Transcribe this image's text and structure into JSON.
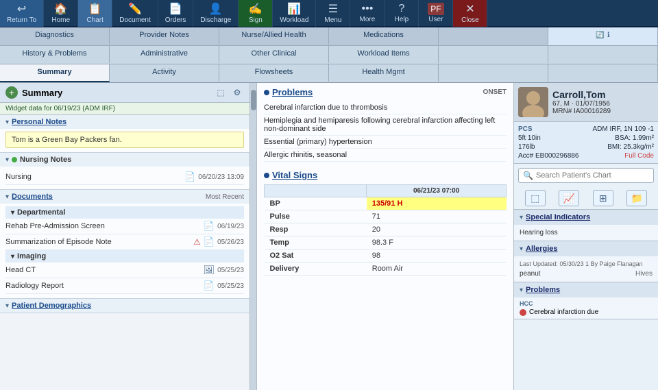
{
  "toolbar": {
    "items": [
      {
        "label": "Return To",
        "icon": "↩",
        "name": "return-to-button"
      },
      {
        "label": "Home",
        "icon": "🏠",
        "name": "home-button"
      },
      {
        "label": "Chart",
        "icon": "📋",
        "name": "chart-button",
        "active": true
      },
      {
        "label": "Document",
        "icon": "✏️",
        "name": "document-button"
      },
      {
        "label": "Orders",
        "icon": "📄",
        "name": "orders-button"
      },
      {
        "label": "Discharge",
        "icon": "👤",
        "name": "discharge-button"
      },
      {
        "label": "Sign",
        "icon": "✍️",
        "name": "sign-button"
      },
      {
        "label": "Workload",
        "icon": "📊",
        "name": "workload-button"
      },
      {
        "label": "Menu",
        "icon": "☰",
        "name": "menu-button"
      },
      {
        "label": "More",
        "icon": "•••",
        "name": "more-button"
      },
      {
        "label": "Help",
        "icon": "?",
        "name": "help-button"
      },
      {
        "label": "PF\nUser",
        "icon": "👤",
        "name": "user-button"
      },
      {
        "label": "Close",
        "icon": "✕",
        "name": "close-button"
      }
    ]
  },
  "nav": {
    "row1": [
      {
        "label": "Diagnostics",
        "name": "nav-diagnostics"
      },
      {
        "label": "Provider Notes",
        "name": "nav-provider-notes"
      },
      {
        "label": "Nurse/Allied Health",
        "name": "nav-nurse"
      },
      {
        "label": "Medications",
        "name": "nav-medications"
      },
      {
        "label": "",
        "name": "nav-empty1"
      },
      {
        "label": "",
        "name": "nav-empty2"
      }
    ],
    "row2": [
      {
        "label": "History & Problems",
        "name": "nav-history"
      },
      {
        "label": "Administrative",
        "name": "nav-administrative"
      },
      {
        "label": "Other Clinical",
        "name": "nav-other-clinical"
      },
      {
        "label": "Workload Items",
        "name": "nav-workload"
      },
      {
        "label": "",
        "name": "nav-empty3"
      },
      {
        "label": "",
        "name": "nav-empty4"
      }
    ],
    "row3": [
      {
        "label": "Summary",
        "name": "nav-summary",
        "active": true
      },
      {
        "label": "Activity",
        "name": "nav-activity"
      },
      {
        "label": "Flowsheets",
        "name": "nav-flowsheets"
      },
      {
        "label": "Health Mgmt",
        "name": "nav-health-mgmt"
      },
      {
        "label": "",
        "name": "nav-empty5"
      },
      {
        "label": "",
        "name": "nav-empty6"
      }
    ]
  },
  "panel": {
    "title": "Summary",
    "widget_info": "Widget data for 06/19/23 (ADM IRF)",
    "add_label": "+",
    "settings_icon": "⚙",
    "expand_icon": "⤢"
  },
  "personal_notes": {
    "title": "Personal Notes",
    "content": "Tom is a Green Bay Packers fan."
  },
  "nursing_notes": {
    "title": "Nursing Notes",
    "dot_color": "green",
    "entries": [
      {
        "name": "Nursing",
        "date": "06/20/23 13:09"
      }
    ]
  },
  "documents": {
    "title": "Documents",
    "most_recent": "Most Recent",
    "subsections": [
      {
        "name": "Departmental",
        "items": [
          {
            "name": "Rehab Pre-Admission Screen",
            "date": "06/19/23",
            "has_icon": true
          },
          {
            "name": "Summarization of Episode Note",
            "date": "05/26/23",
            "has_icon": true,
            "has_warn": true
          }
        ]
      },
      {
        "name": "Imaging",
        "items": [
          {
            "name": "Head CT",
            "date": "05/25/23",
            "has_icon": true
          },
          {
            "name": "Radiology Report",
            "date": "05/25/23",
            "has_icon": true
          }
        ]
      }
    ]
  },
  "patient_demographics": {
    "title": "Patient Demographics",
    "name": "patient-demographics-link"
  },
  "problems": {
    "title": "Problems",
    "onset_label": "ONSET",
    "items": [
      "Cerebral infarction due to thrombosis",
      "Hemiplegia and hemiparesis following cerebral infarction affecting left non-dominant side",
      "Essential (primary) hypertension",
      "Allergic rhinitis, seasonal"
    ]
  },
  "vital_signs": {
    "title": "Vital Signs",
    "date_col": "06/21/23\n07:00",
    "rows": [
      {
        "label": "BP",
        "value": "135/91 H",
        "highlight": true
      },
      {
        "label": "Pulse",
        "value": "71",
        "highlight": false
      },
      {
        "label": "Resp",
        "value": "20",
        "highlight": false
      },
      {
        "label": "Temp",
        "value": "98.3 F",
        "highlight": false
      },
      {
        "label": "O2 Sat",
        "value": "98",
        "highlight": false
      },
      {
        "label": "Delivery",
        "value": "Room Air",
        "highlight": false
      }
    ]
  },
  "patient": {
    "name": "Carroll,Tom",
    "age": "67, M · 01/07/1956",
    "mrn": "MRN# IA00016289",
    "location": "ADM IRF, 1N  109 -1",
    "height": "5ft 10in",
    "weight": "176lb",
    "bsa": "BSA: 1.99m²",
    "bmi": "BMI: 25.3kg/m²",
    "acc": "Acc#\nEB000296886",
    "full_code": "Full Code",
    "pcs_label": "PCS",
    "search_placeholder": "Search Patient's Chart"
  },
  "special_indicators": {
    "title": "Special Indicators",
    "items": [
      "Hearing loss"
    ]
  },
  "allergies": {
    "title": "Allergies",
    "updated": "Last Updated: 05/30/23 1 By Paige Flanagan",
    "items": [
      {
        "name": "peanut",
        "type": "Hives"
      }
    ]
  },
  "right_problems": {
    "title": "Problems",
    "hcc_label": "HCC",
    "items": [
      "Cerebral infarction due"
    ]
  },
  "icons": {
    "chevron_down": "▾",
    "chevron_right": "▸",
    "search": "🔍",
    "file": "📄",
    "image": "🖼",
    "refresh": "🔄",
    "info": "ℹ",
    "plus": "＋",
    "settings": "⚙",
    "expand": "⬚",
    "chart_icon": "📈",
    "grid_icon": "⊞",
    "star_icon": "★",
    "folder_icon": "📁"
  }
}
